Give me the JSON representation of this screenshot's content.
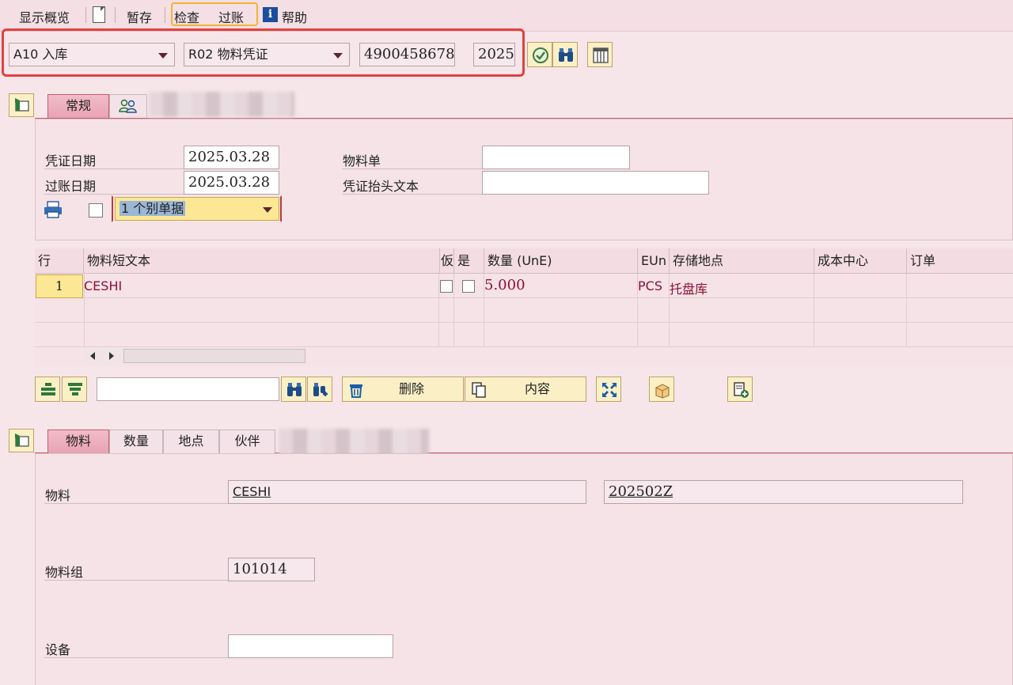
{
  "menu": {
    "overview": "显示概览",
    "hold": "暂存",
    "check": "检查",
    "post": "过账",
    "help": "帮助"
  },
  "header": {
    "action": "A10 入库",
    "reference": "R02 物料凭证",
    "doc_number": "4900458678",
    "year": "2025"
  },
  "top_tabs": [
    {
      "label": "常规"
    }
  ],
  "general": {
    "doc_date_label": "凭证日期",
    "doc_date": "2025.03.28",
    "post_date_label": "过账日期",
    "post_date": "2025.03.28",
    "material_slip_label": "物料单",
    "material_slip": "",
    "header_text_label": "凭证抬头文本",
    "header_text": "",
    "print_option": "1 个别单据"
  },
  "table": {
    "headers": [
      "行",
      "物料短文本",
      "仮",
      "是",
      "数量 (UnE)",
      "EUn",
      "存储地点",
      "成本中心",
      "订单"
    ],
    "rows": [
      {
        "line": "1",
        "text": "CESHI",
        "qty": "5.000",
        "unit": "PCS",
        "sloc": "托盘库",
        "cost_center": "",
        "order": ""
      }
    ]
  },
  "actions": {
    "search_value": "",
    "delete": "删除",
    "contents": "内容"
  },
  "detail_tabs": [
    "物料",
    "数量",
    "地点",
    "伙伴"
  ],
  "detail": {
    "material_label": "物料",
    "material": "CESHI",
    "batch": "202502Z",
    "material_group_label": "物料组",
    "material_group": "101014",
    "equipment_label": "设备",
    "equipment": ""
  }
}
